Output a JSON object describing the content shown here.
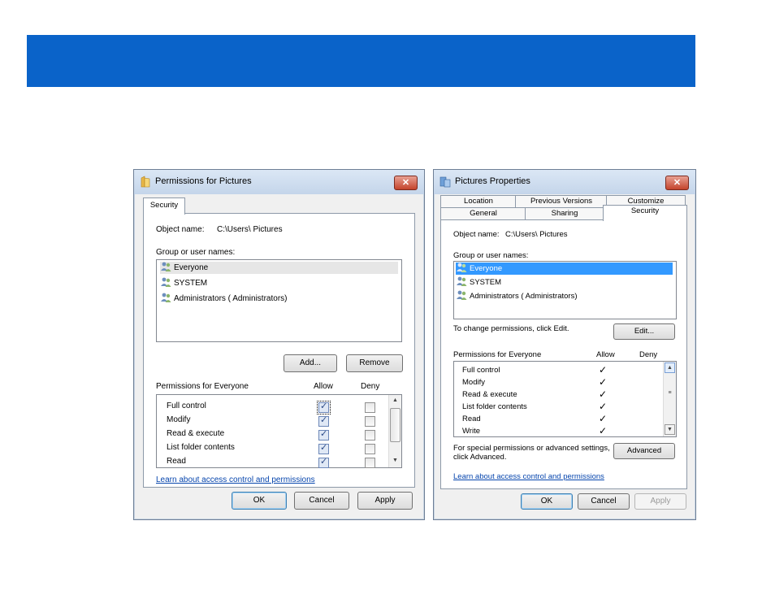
{
  "left_dialog": {
    "title": "Permissions for Pictures",
    "tab": "Security",
    "object_label": "Object name:",
    "object_path": "C:\\Users\\ Pictures",
    "group_label": "Group or user names:",
    "users": [
      "Everyone",
      "SYSTEM",
      "Administrators ( Administrators)"
    ],
    "add_label": "Add...",
    "remove_label": "Remove",
    "perm_label": "Permissions for Everyone",
    "allow_label": "Allow",
    "deny_label": "Deny",
    "permissions": [
      "Full control",
      "Modify",
      "Read & execute",
      "List folder contents",
      "Read"
    ],
    "link": "Learn about access control and permissions",
    "ok": "OK",
    "cancel": "Cancel",
    "apply": "Apply"
  },
  "right_dialog": {
    "title": "Pictures Properties",
    "tabs_top": [
      "Location",
      "Previous Versions",
      "Customize"
    ],
    "tabs_bottom": [
      "General",
      "Sharing",
      "Security"
    ],
    "object_label": "Object name:",
    "object_path": "C:\\Users\\ Pictures",
    "group_label": "Group or user names:",
    "users": [
      "Everyone",
      "SYSTEM",
      "Administrators ( Administrators)"
    ],
    "change_text": "To change permissions, click Edit.",
    "edit_label": "Edit...",
    "perm_label": "Permissions for Everyone",
    "allow_label": "Allow",
    "deny_label": "Deny",
    "permissions": [
      "Full control",
      "Modify",
      "Read & execute",
      "List folder contents",
      "Read",
      "Write"
    ],
    "special_line1": "For special permissions or advanced settings,",
    "special_line2": "click Advanced.",
    "advanced_label": "Advanced",
    "link": "Learn about access control and permissions",
    "ok": "OK",
    "cancel": "Cancel",
    "apply": "Apply"
  },
  "check_glyph": "✓",
  "icons": [
    "folder-icon",
    "close-icon",
    "users-icon",
    "folder-properties-icon"
  ],
  "colors": {
    "banner": "#0a63c9",
    "selection": "#3399ff",
    "link": "#0645ad"
  }
}
